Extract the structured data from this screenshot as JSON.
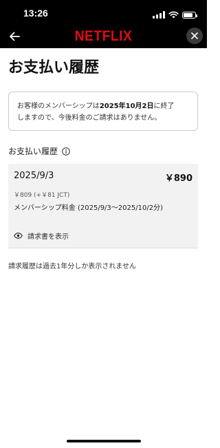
{
  "status_bar": {
    "time": "13:26",
    "battery_level": 0.8
  },
  "nav": {
    "logo_text": "NETFLIX",
    "back_icon": "arrow-left-icon",
    "close_icon": "close-icon",
    "brand_color": "#e50914"
  },
  "page": {
    "title": "お支払い履歴"
  },
  "notice": {
    "prefix": "お客様のメンバーシップは",
    "date": "2025年10月2日",
    "suffix": "に終了",
    "line2": "しますので、今後料金のご請求はありません。"
  },
  "history": {
    "section_title": "お支払い履歴",
    "items": [
      {
        "date": "2025/9/3",
        "amount": "￥890",
        "tax_detail": "￥809 (+￥81 JCT)",
        "description": "メンバーシップ料金 (2025/9/3～2025/10/2分)",
        "invoice_label": "請求書を表示"
      }
    ]
  },
  "footer": {
    "note": "請求履歴は過去1年分しか表示されません"
  }
}
